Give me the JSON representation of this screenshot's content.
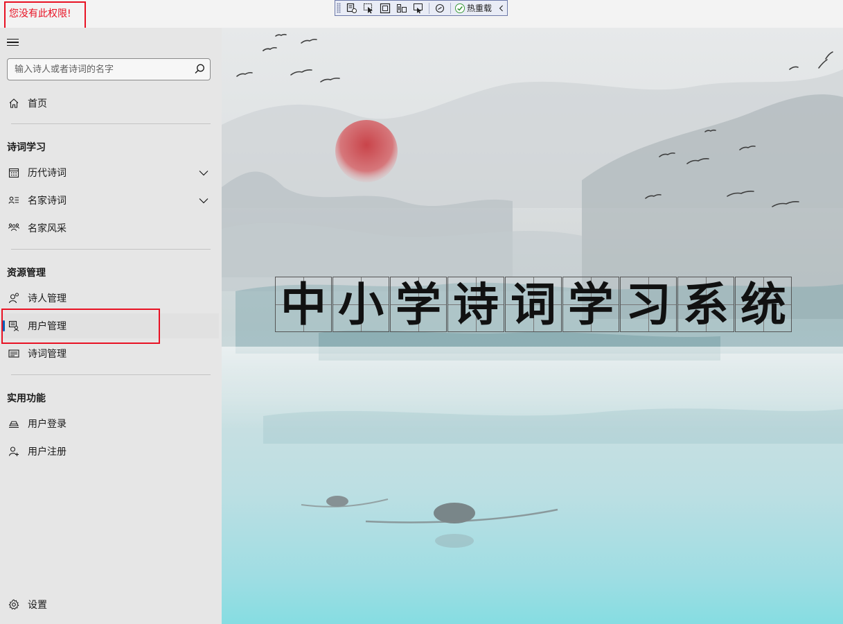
{
  "titlebar": {
    "error_message": "您没有此权限!"
  },
  "debug_toolbar": {
    "hot_reload_label": "热重载",
    "buttons": [
      "live-visual-tree-icon",
      "select-element-icon",
      "display-layout-adorners-icon",
      "track-focus-icon",
      "show-binding-failures-icon",
      "xaml-binding-icon"
    ]
  },
  "sidebar": {
    "search": {
      "placeholder": "输入诗人或者诗词的名字",
      "value": ""
    },
    "home": {
      "label": "首页",
      "icon": "home-icon"
    },
    "groups": [
      {
        "header": "诗词学习",
        "items": [
          {
            "label": "历代诗词",
            "icon": "calendar-icon",
            "expandable": true
          },
          {
            "label": "名家诗词",
            "icon": "contact-list-icon",
            "expandable": true
          },
          {
            "label": "名家风采",
            "icon": "people-icon",
            "expandable": false
          }
        ]
      },
      {
        "header": "资源管理",
        "items": [
          {
            "label": "诗人管理",
            "icon": "person-icon",
            "expandable": false
          },
          {
            "label": "用户管理",
            "icon": "user-manage-icon",
            "expandable": false,
            "selected": true
          },
          {
            "label": "诗词管理",
            "icon": "document-icon",
            "expandable": false
          }
        ]
      },
      {
        "header": "实用功能",
        "items": [
          {
            "label": "用户登录",
            "icon": "login-icon",
            "expandable": false
          },
          {
            "label": "用户注册",
            "icon": "add-user-icon",
            "expandable": false
          }
        ]
      }
    ],
    "settings": {
      "label": "设置",
      "icon": "gear-icon"
    }
  },
  "main": {
    "title_chars": [
      "中",
      "小",
      "学",
      "诗",
      "词",
      "学",
      "习",
      "系",
      "统"
    ]
  },
  "colors": {
    "error": "#e81123",
    "accent": "#005fb8",
    "sidebar_bg": "#e6e6e6",
    "sun": "#c9444a"
  }
}
